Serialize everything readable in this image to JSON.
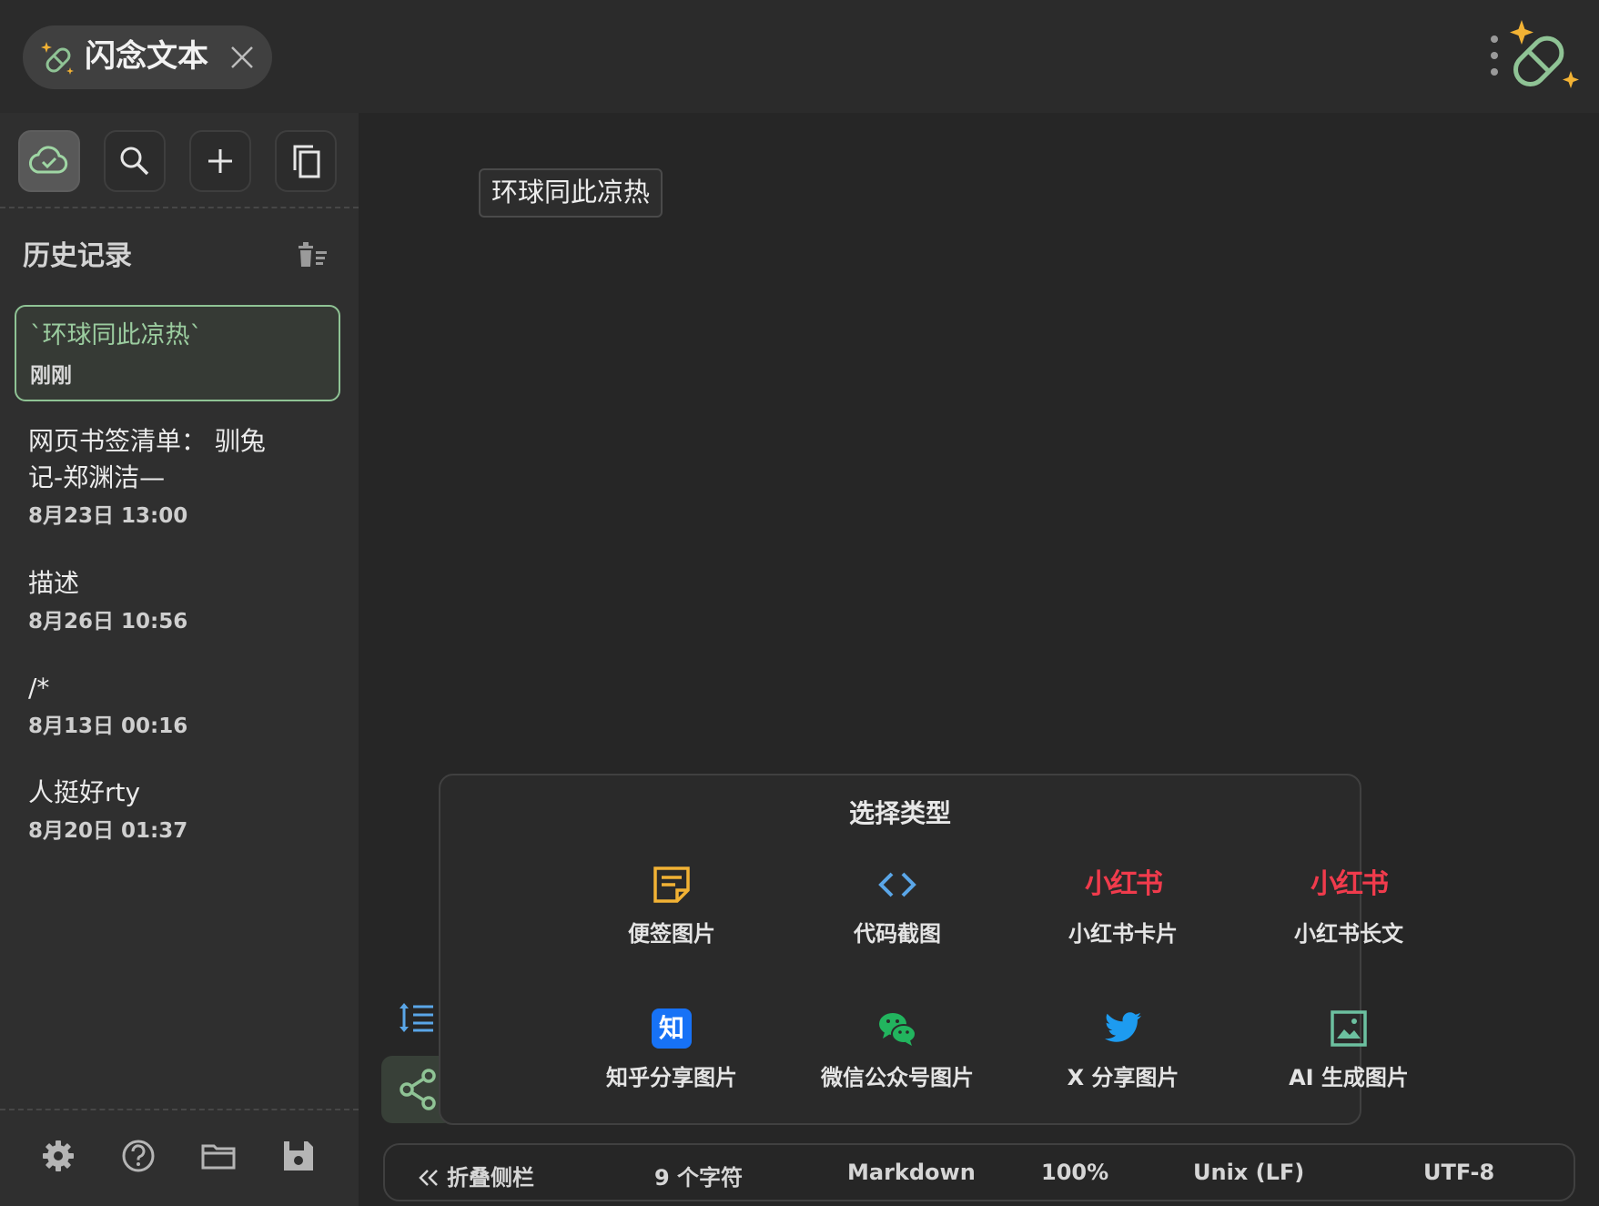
{
  "window": {
    "tab_title": "闪念文本",
    "brand_green": "#8fc395",
    "brand_gold": "#f2b234"
  },
  "toolbar": {
    "icons": [
      "cloud-check-icon",
      "search-icon",
      "plus-icon",
      "copy-icon"
    ]
  },
  "history": {
    "title": "历史记录",
    "items": [
      {
        "text": "`环球同此凉热`",
        "date": "刚刚",
        "active": true
      },
      {
        "text": "网页书签清单：  驯兔记-郑渊洁—",
        "date": "8月23日 13:00"
      },
      {
        "text": "描述",
        "date": "8月26日 10:56"
      },
      {
        "text": "/*",
        "date": "8月13日 00:16"
      },
      {
        "text": "人挺好rty",
        "date": "8月20日 01:37"
      }
    ]
  },
  "editor": {
    "content": "环球同此凉热"
  },
  "share_popup": {
    "title": "选择类型",
    "options": [
      {
        "label": "便签图片",
        "icon": "sticky-note-icon"
      },
      {
        "label": "代码截图",
        "icon": "code-icon"
      },
      {
        "label": "小红书卡片",
        "icon": "xiaohongshu-logo",
        "logo_text": "小红书"
      },
      {
        "label": "小红书长文",
        "icon": "xiaohongshu-logo",
        "logo_text": "小红书"
      },
      {
        "label": "知乎分享图片",
        "icon": "zhihu-icon",
        "logo_text": "知"
      },
      {
        "label": "微信公众号图片",
        "icon": "wechat-icon"
      },
      {
        "label": "X 分享图片",
        "icon": "twitter-bird-icon"
      },
      {
        "label": "AI 生成图片",
        "icon": "image-icon"
      }
    ]
  },
  "statusbar": {
    "collapse": "折叠侧栏",
    "char_count": "9 个字符",
    "language": "Markdown",
    "zoom": "100%",
    "line_ending": "Unix (LF)",
    "encoding": "UTF-8"
  }
}
